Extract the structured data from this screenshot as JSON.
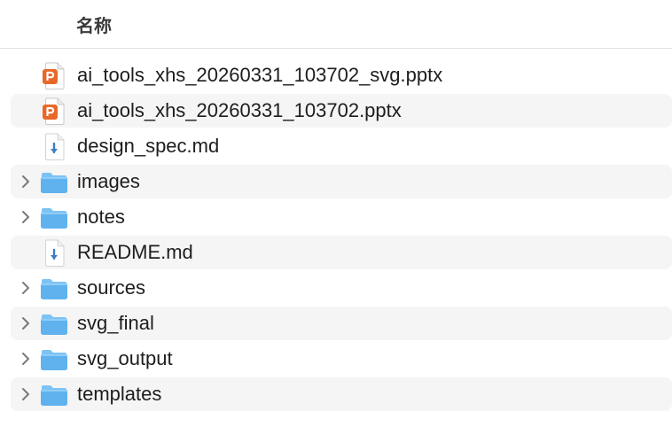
{
  "header": {
    "name_column": "名称"
  },
  "colors": {
    "folder": "#5fb2ee",
    "folder_tab": "#7cc3f4",
    "pptx_badge": "#e8682a",
    "md_arrow": "#3a7ec2",
    "row_stripe": "#f5f5f5"
  },
  "files": [
    {
      "name": "ai_tools_xhs_20260331_103702_svg.pptx",
      "kind": "pptx",
      "expandable": false,
      "striped": false
    },
    {
      "name": "ai_tools_xhs_20260331_103702.pptx",
      "kind": "pptx",
      "expandable": false,
      "striped": true
    },
    {
      "name": "design_spec.md",
      "kind": "markdown",
      "expandable": false,
      "striped": false
    },
    {
      "name": "images",
      "kind": "folder",
      "expandable": true,
      "striped": true
    },
    {
      "name": "notes",
      "kind": "folder",
      "expandable": true,
      "striped": false
    },
    {
      "name": "README.md",
      "kind": "markdown",
      "expandable": false,
      "striped": true
    },
    {
      "name": "sources",
      "kind": "folder",
      "expandable": true,
      "striped": false
    },
    {
      "name": "svg_final",
      "kind": "folder",
      "expandable": true,
      "striped": true
    },
    {
      "name": "svg_output",
      "kind": "folder",
      "expandable": true,
      "striped": false
    },
    {
      "name": "templates",
      "kind": "folder",
      "expandable": true,
      "striped": true
    }
  ]
}
